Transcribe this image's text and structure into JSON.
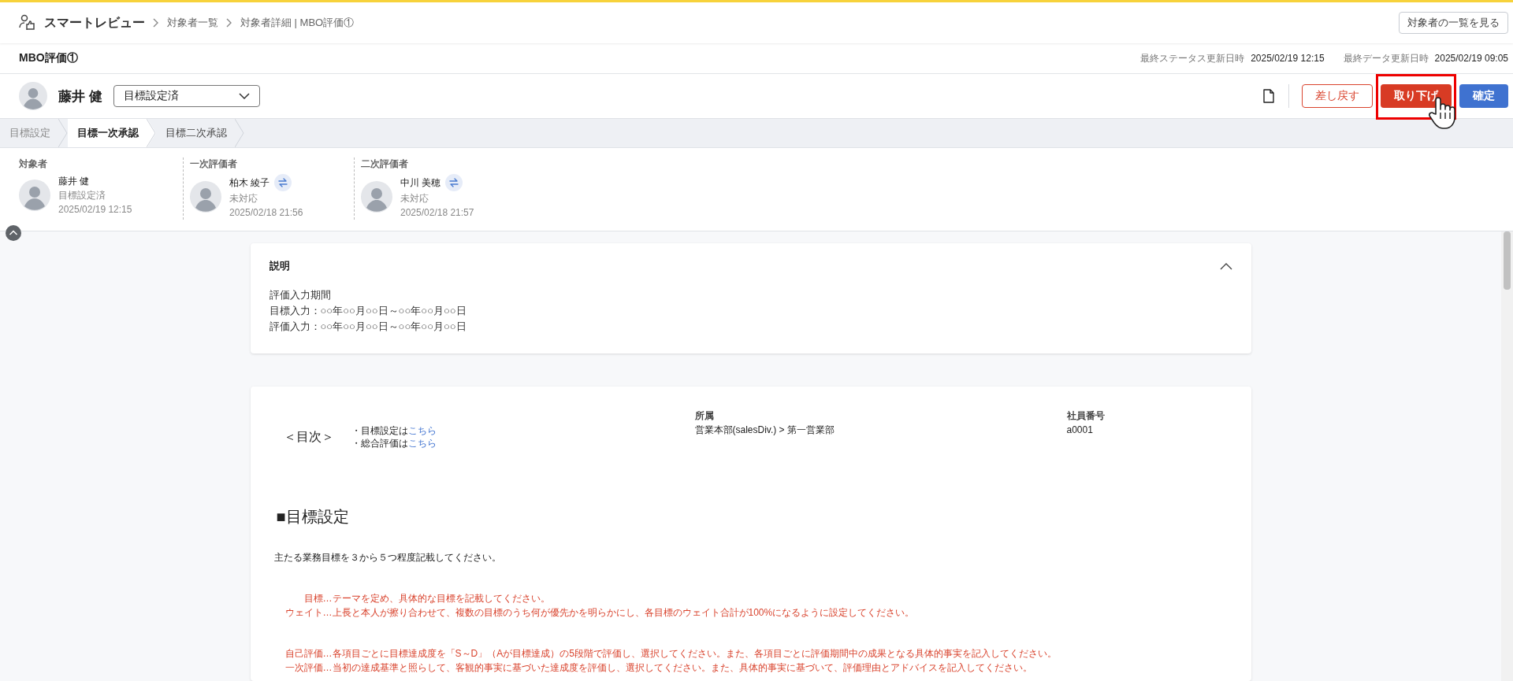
{
  "header": {
    "app_name": "スマートレビュー",
    "breadcrumbs": [
      "対象者一覧",
      "対象者詳細 | MBO評価①"
    ],
    "list_button": "対象者の一覧を見る"
  },
  "title_bar": {
    "title": "MBO評価①",
    "meta": [
      {
        "label": "最終ステータス更新日時",
        "value": "2025/02/19 12:15"
      },
      {
        "label": "最終データ更新日時",
        "value": "2025/02/19 09:05"
      }
    ]
  },
  "person": {
    "name": "藤井 健",
    "status_select": {
      "value": "目標設定済"
    }
  },
  "actions": [
    {
      "label": "差し戻す",
      "kind": "outline",
      "highlighted": false
    },
    {
      "label": "取り下げ",
      "kind": "danger",
      "highlighted": true
    },
    {
      "label": "確定",
      "kind": "primary",
      "highlighted": false
    }
  ],
  "steps": [
    {
      "label": "目標設定",
      "completed": true,
      "selected": false
    },
    {
      "label": "目標一次承認",
      "completed": false,
      "selected": true
    },
    {
      "label": "目標二次承認",
      "completed": false,
      "selected": false
    }
  ],
  "evaluators": [
    {
      "role": "対象者",
      "name": "藤井 健",
      "status": "目標設定済",
      "time": "2025/02/19 12:15",
      "swappable": false
    },
    {
      "role": "一次評価者",
      "name": "柏木 綾子",
      "status": "未対応",
      "time": "2025/02/18 21:56",
      "swappable": true
    },
    {
      "role": "二次評価者",
      "name": "中川 美穂",
      "status": "未対応",
      "time": "2025/02/18 21:57",
      "swappable": true
    }
  ],
  "description_card": {
    "title": "説明",
    "expanded": true,
    "lines": [
      "評価入力期間",
      "目標入力：○○年○○月○○日～○○年○○月○○日",
      "評価入力：○○年○○月○○日～○○年○○月○○日"
    ]
  },
  "sheet": {
    "toc": {
      "label": "＜目次＞",
      "items": [
        {
          "text": "・目標設定は",
          "link": "こちら"
        },
        {
          "text": "・総合評価は",
          "link": "こちら"
        }
      ]
    },
    "fields": [
      {
        "label": "所属",
        "value": "営業本部(salesDiv.) > 第一営業部"
      },
      {
        "label": "社員番号",
        "value": "a0001"
      }
    ],
    "section_title": "■目標設定",
    "intro": "主たる業務目標を３から５つ程度記載してください。",
    "note_groups": [
      [
        "　　目標…テーマを定め、具体的な目標を記載してください。",
        "ウェイト…上長と本人が擦り合わせて、複数の目標のうち何が優先かを明らかにし、各目標のウェイト合計が100%になるように設定してください。"
      ],
      [
        "自己評価…各項目ごとに目標達成度を「S～D」（Aが目標達成）の5段階で評価し、選択してください。また、各項目ごとに評価期間中の成果となる具体的事実を記入してください。",
        "一次評価…当初の達成基準と照らして、客観的事実に基づいた達成度を評価し、選択してください。また、具体的事実に基づいて、評価理由とアドバイスを記入してください。"
      ]
    ]
  }
}
